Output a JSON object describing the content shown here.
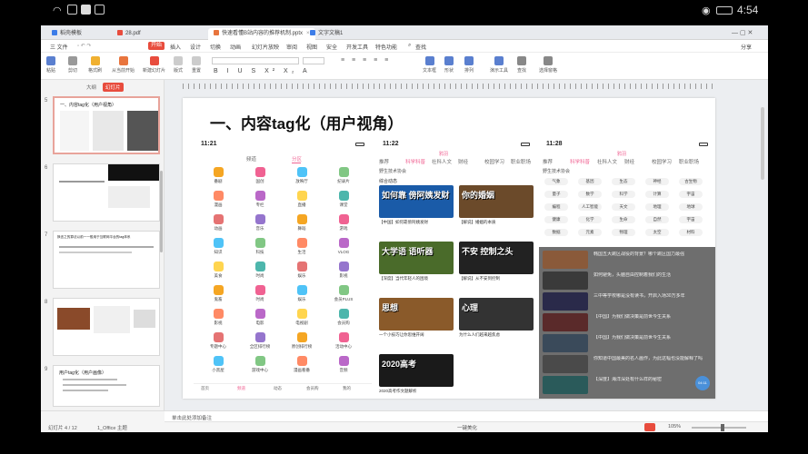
{
  "status_bar": {
    "time": "4:54"
  },
  "app": {
    "tabs": [
      {
        "label": "稻壳模板",
        "color": "#e84c3d"
      },
      {
        "label": "28.pdf",
        "color": "#e84c3d"
      },
      {
        "label": "快速看懂B站内容的推荐机制.pptx",
        "color": "#e8743d"
      },
      {
        "label": "文字文稿1",
        "color": "#3d7de8"
      }
    ],
    "menu": {
      "file": "三 文件",
      "items": [
        "开始",
        "插入",
        "设计",
        "切换",
        "动画",
        "幻灯片放映",
        "审阅",
        "视图",
        "安全",
        "开发工具",
        "特色功能"
      ],
      "active": "开始",
      "search": "查找",
      "right": [
        "分享"
      ]
    },
    "ribbon": [
      {
        "label": "粘贴",
        "color": "#5a7fcf"
      },
      {
        "label": "剪切",
        "color": "#999999"
      },
      {
        "label": "格式刷",
        "color": "#f0b030"
      },
      {
        "label": "从当前开始",
        "color": "#e8743d"
      },
      {
        "label": "新建幻灯片",
        "color": "#e84c3d"
      },
      {
        "label": "版式",
        "color": "#aaaaaa"
      },
      {
        "label": "重置",
        "color": "#aaaaaa"
      },
      {
        "label": "文本框",
        "color": "#5a7fcf"
      },
      {
        "label": "形状",
        "color": "#5a7fcf"
      },
      {
        "label": "排列",
        "color": "#5a7fcf"
      },
      {
        "label": "演示工具",
        "color": "#5a7fcf"
      },
      {
        "label": "查找",
        "color": "#777777"
      },
      {
        "label": "替换",
        "color": "#777777"
      },
      {
        "label": "选择",
        "color": "#777777"
      },
      {
        "label": "选择窗格",
        "color": "#777777"
      }
    ],
    "sidebar": {
      "tabs": [
        "大纲",
        "幻灯片"
      ],
      "active_tab": "幻灯片",
      "thumbnails": [
        {
          "num": "5",
          "title": "一、内容tag化（用户视角）"
        },
        {
          "num": "6",
          "title": ""
        },
        {
          "num": "7",
          "title": "换言之的算法以前一一般用于互联网平台的tag体系"
        },
        {
          "num": "8",
          "title": ""
        },
        {
          "num": "9",
          "title": "用户tag化（用户画像）"
        }
      ]
    },
    "slide": {
      "title": "一、内容tag化（用户视角）",
      "phone1": {
        "time": "11:21",
        "tabs": [
          "频道",
          "分区"
        ],
        "grid": [
          "番剧",
          "国创",
          "放映厅",
          "纪录片",
          "漫画",
          "专栏",
          "直播",
          "课堂",
          "动画",
          "音乐",
          "舞蹈",
          "游戏",
          "知识",
          "科技",
          "生活",
          "VLOG",
          "美食",
          "时尚",
          "娱乐",
          "影视",
          "鬼畜",
          "时尚",
          "娱乐",
          "会员PLUS",
          "影视",
          "电影",
          "电视剧",
          "会员购",
          "专题中心",
          "全区排行榜",
          "原创排行榜",
          "活动中心",
          "小黑屋",
          "游戏中心",
          "漫画看番",
          "音频"
        ],
        "nav": [
          "首页",
          "频道",
          "动态",
          "会员购",
          "我的"
        ]
      },
      "phone2": {
        "time": "11:22",
        "search": "鸦羽",
        "tabs": [
          "推荐",
          "科学科普",
          "社科人文",
          "财经",
          "校园学习",
          "职业职场"
        ],
        "section": "野生技术协会",
        "hot": "综合动态",
        "cards": [
          {
            "title": "如何靠 傍阿姨发财",
            "caption": "【中国】如何靠傍阿姨发财",
            "color": "#1a5ba8"
          },
          {
            "title": "你的婚姻",
            "caption": "【解说】婚姻的本质",
            "color": "#6b4a2a"
          },
          {
            "title": "大学语 语听器",
            "caption": "【深度】当代年轻人的困境",
            "color": "#4a6b2a"
          },
          {
            "title": "不安 控制之头",
            "caption": "【解说】从不安到控制",
            "color": "#222222"
          },
          {
            "title": "思想",
            "caption": "一个小技巧让你思维开阔",
            "color": "#8a5a2a"
          },
          {
            "title": "心理",
            "caption": "为什么人们越来越焦虑",
            "color": "#333333"
          },
          {
            "title": "2020高考",
            "caption": "2020高考作文题解析",
            "color": "#1a1a1a"
          }
        ]
      },
      "phone3": {
        "time": "11:28",
        "search": "鸦羽",
        "tabs": [
          "推荐",
          "科学科普",
          "社科人文",
          "财经",
          "校园学习",
          "职业职场"
        ],
        "section": "野生技术协会",
        "chips": [
          "气象",
          "基因",
          "生态",
          "神经",
          "古生物",
          "量子",
          "数学",
          "科学",
          "计算",
          "宇宙",
          "编程",
          "人工智能",
          "天文",
          "地理",
          "地球",
          "健康",
          "化学",
          "生命",
          "自然",
          "宇宙",
          "数据",
          "元素",
          "物理",
          "太空",
          "材料"
        ],
        "news": [
          "韩国五大跳区战役的背景？哪个跳区国力最强",
          "如何避免，头脑自由控制着我们的生活",
          "三中等学校哪是没有读书，开启入场30万多年",
          "【中国】为我们做决策是前世今生关系",
          "【中国】为我们做决策是前世今生关系",
          "你知道中国最美的名人画作，为此这幅也没能解释了吗",
          "【深度】海洋深处有什么样的秘密"
        ]
      }
    },
    "notes_placeholder": "单击此处添加备注",
    "footer": {
      "page": "幻灯片 4 / 12",
      "theme": "1_Office 主题",
      "notes_label": "一键美化",
      "zoom": "105%"
    }
  }
}
